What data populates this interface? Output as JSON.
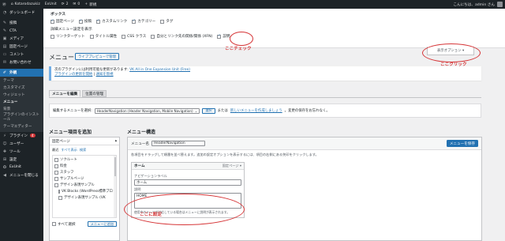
{
  "adminbar": {
    "site_name": "Kotarodazukiz",
    "plugin": "ExUnit",
    "updates": "2",
    "comments": "0",
    "new_label": "新規",
    "greeting": "こんにちは、admin さん"
  },
  "sidebar": {
    "items": [
      {
        "label": "ダッシュボード",
        "icon": "dashboard-icon"
      },
      {
        "label": "投稿",
        "icon": "pin-icon"
      },
      {
        "label": "CTA",
        "icon": "cta-icon"
      },
      {
        "label": "メディア",
        "icon": "media-icon"
      },
      {
        "label": "固定ページ",
        "icon": "page-icon"
      },
      {
        "label": "コメント",
        "icon": "comment-icon"
      },
      {
        "label": "お問い合わせ",
        "icon": "mail-icon"
      },
      {
        "label": "外観",
        "icon": "brush-icon"
      }
    ],
    "appearance_sub": [
      "テーマ",
      "カスタマイズ",
      "ウィジェット",
      "メニュー",
      "背景",
      "プラグインのインストール",
      "テーマエディター"
    ],
    "lower_items": [
      {
        "label": "プラグイン",
        "icon": "plugin-icon",
        "badge": "4"
      },
      {
        "label": "ユーザー",
        "icon": "user-icon"
      },
      {
        "label": "ツール",
        "icon": "wrench-icon"
      },
      {
        "label": "設定",
        "icon": "settings-icon"
      },
      {
        "label": "ExUnit",
        "icon": "exunit-icon"
      },
      {
        "label": "メニューを閉じる",
        "icon": "collapse-icon"
      }
    ]
  },
  "screen_options": {
    "boxes_heading": "ボックス",
    "boxes": [
      {
        "label": "固定ページ",
        "checked": true
      },
      {
        "label": "投稿",
        "checked": true
      },
      {
        "label": "カスタムリンク",
        "checked": true
      },
      {
        "label": "カテゴリー",
        "checked": true
      },
      {
        "label": "タグ",
        "checked": false
      }
    ],
    "advanced_heading": "詳細メニュー設定を表示",
    "advanced": [
      {
        "label": "リンクターゲット",
        "checked": false
      },
      {
        "label": "タイトル属性",
        "checked": false
      },
      {
        "label": "CSS クラス",
        "checked": false
      },
      {
        "label": "自分とリンク先の関係/関係 (XFN)",
        "checked": false
      },
      {
        "label": "説明",
        "checked": true
      }
    ],
    "annotation": "ここチェック"
  },
  "header": {
    "title": "メニュー",
    "live_preview": "ライブプレビューで管理",
    "screen_options_tab": "表示オプション ▾",
    "annotation": "ここクリック"
  },
  "notice": {
    "line1": "次のプラグインには利用可能な更新があります: ",
    "plugin_link": "VK All in One Expansion Unit (Free)",
    "begin_update": "プラグインの更新を開始",
    "separator": " | ",
    "dismiss": "通知を無視"
  },
  "tabs": [
    "メニューを編集",
    "位置の管理"
  ],
  "manage": {
    "label": "編集するメニューを選択:",
    "selected": "HeaderNavigation (Header Navigation, Mobile Navigation)",
    "select_button": "選択",
    "or": "または",
    "create_link": "新しいメニューを作成しましょう",
    "tail": "。変更の保存をお忘れなく。"
  },
  "left": {
    "heading": "メニュー項目を追加",
    "accordion": "固定ページ",
    "subtabs": [
      "最近",
      "すべて表示",
      "検索"
    ],
    "pages": [
      {
        "label": "ソクルート",
        "child": false
      },
      {
        "label": "料金",
        "child": false
      },
      {
        "label": "スタッフ",
        "child": false
      },
      {
        "label": "サンプルページ",
        "child": false
      },
      {
        "label": "デザイン表現サンプル",
        "child": false
      },
      {
        "label": "VK Blocks (WordPress標準ブロック拡張)",
        "child": true
      },
      {
        "label": "デザイン表現サンプル (VK",
        "child": true
      }
    ],
    "select_all": "すべて選択",
    "add_button": "メニューに追加"
  },
  "right": {
    "heading": "メニュー構造",
    "name_label": "メニュー名",
    "name_value": "HeaderNavigation",
    "save_button": "メニューを保存",
    "description": "各項目をドラッグして順番を並べ替えます。追加の設定オプションを表示するには、項目の右側にある矢印をクリックします。",
    "item_title": "ホーム",
    "item_type": "固定ページ ▾",
    "nav_label_caption": "ナビゲーションラベル",
    "nav_label_value": "ホーム",
    "desc_caption": "説明",
    "desc_value": "HOME",
    "desc_note": "使用中のテーマが対応している場合はメニューに説明が表示されます。",
    "annotation": "ここに設定"
  }
}
